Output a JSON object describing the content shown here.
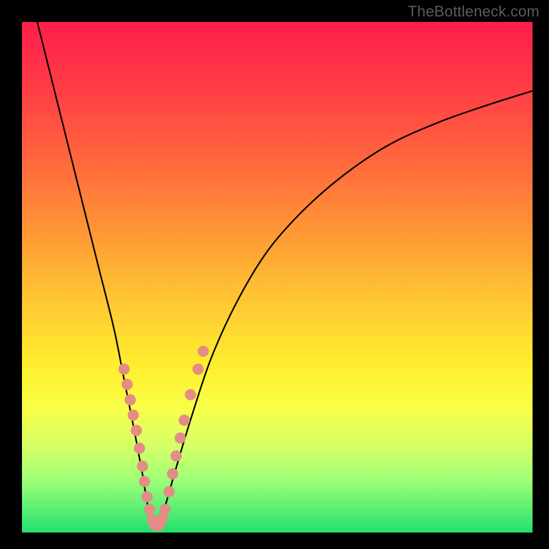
{
  "watermark": "TheBottleneck.com",
  "colors": {
    "frame_bg": "#000000",
    "curve": "#000000",
    "dot": "#e38d86",
    "watermark_text": "#5b5b5b"
  },
  "chart_data": {
    "type": "line",
    "title": "",
    "xlabel": "",
    "ylabel": "",
    "xlim": [
      0,
      100
    ],
    "ylim": [
      0,
      100
    ],
    "grid": false,
    "series": [
      {
        "name": "bottleneck-curve",
        "x": [
          3,
          6,
          9,
          12,
          15,
          18,
          20,
          22,
          23.5,
          24.5,
          25.3,
          26,
          27,
          28,
          30,
          33,
          37,
          42,
          48,
          55,
          63,
          72,
          82,
          92,
          100
        ],
        "y": [
          100,
          88,
          76,
          64,
          52,
          40,
          30,
          20,
          12,
          6,
          2,
          1,
          2,
          5,
          12,
          22,
          34,
          45,
          55,
          63,
          70,
          76,
          80.5,
          84,
          86.5
        ]
      }
    ],
    "markers": [
      {
        "x": 20.0,
        "y": 32.0
      },
      {
        "x": 20.6,
        "y": 29.0
      },
      {
        "x": 21.2,
        "y": 26.0
      },
      {
        "x": 21.8,
        "y": 23.0
      },
      {
        "x": 22.4,
        "y": 20.0
      },
      {
        "x": 23.0,
        "y": 16.5
      },
      {
        "x": 23.6,
        "y": 13.0
      },
      {
        "x": 24.0,
        "y": 10.0
      },
      {
        "x": 24.5,
        "y": 7.0
      },
      {
        "x": 25.0,
        "y": 4.5
      },
      {
        "x": 25.5,
        "y": 2.5
      },
      {
        "x": 26.0,
        "y": 1.5
      },
      {
        "x": 26.5,
        "y": 1.3
      },
      {
        "x": 27.0,
        "y": 1.6
      },
      {
        "x": 27.5,
        "y": 2.8
      },
      {
        "x": 28.0,
        "y": 4.5
      },
      {
        "x": 28.8,
        "y": 8.0
      },
      {
        "x": 29.5,
        "y": 11.5
      },
      {
        "x": 30.2,
        "y": 15.0
      },
      {
        "x": 31.0,
        "y": 18.5
      },
      {
        "x": 31.8,
        "y": 22.0
      },
      {
        "x": 33.0,
        "y": 27.0
      },
      {
        "x": 34.5,
        "y": 32.0
      },
      {
        "x": 35.5,
        "y": 35.5
      }
    ],
    "marker_radius": 1.1
  }
}
